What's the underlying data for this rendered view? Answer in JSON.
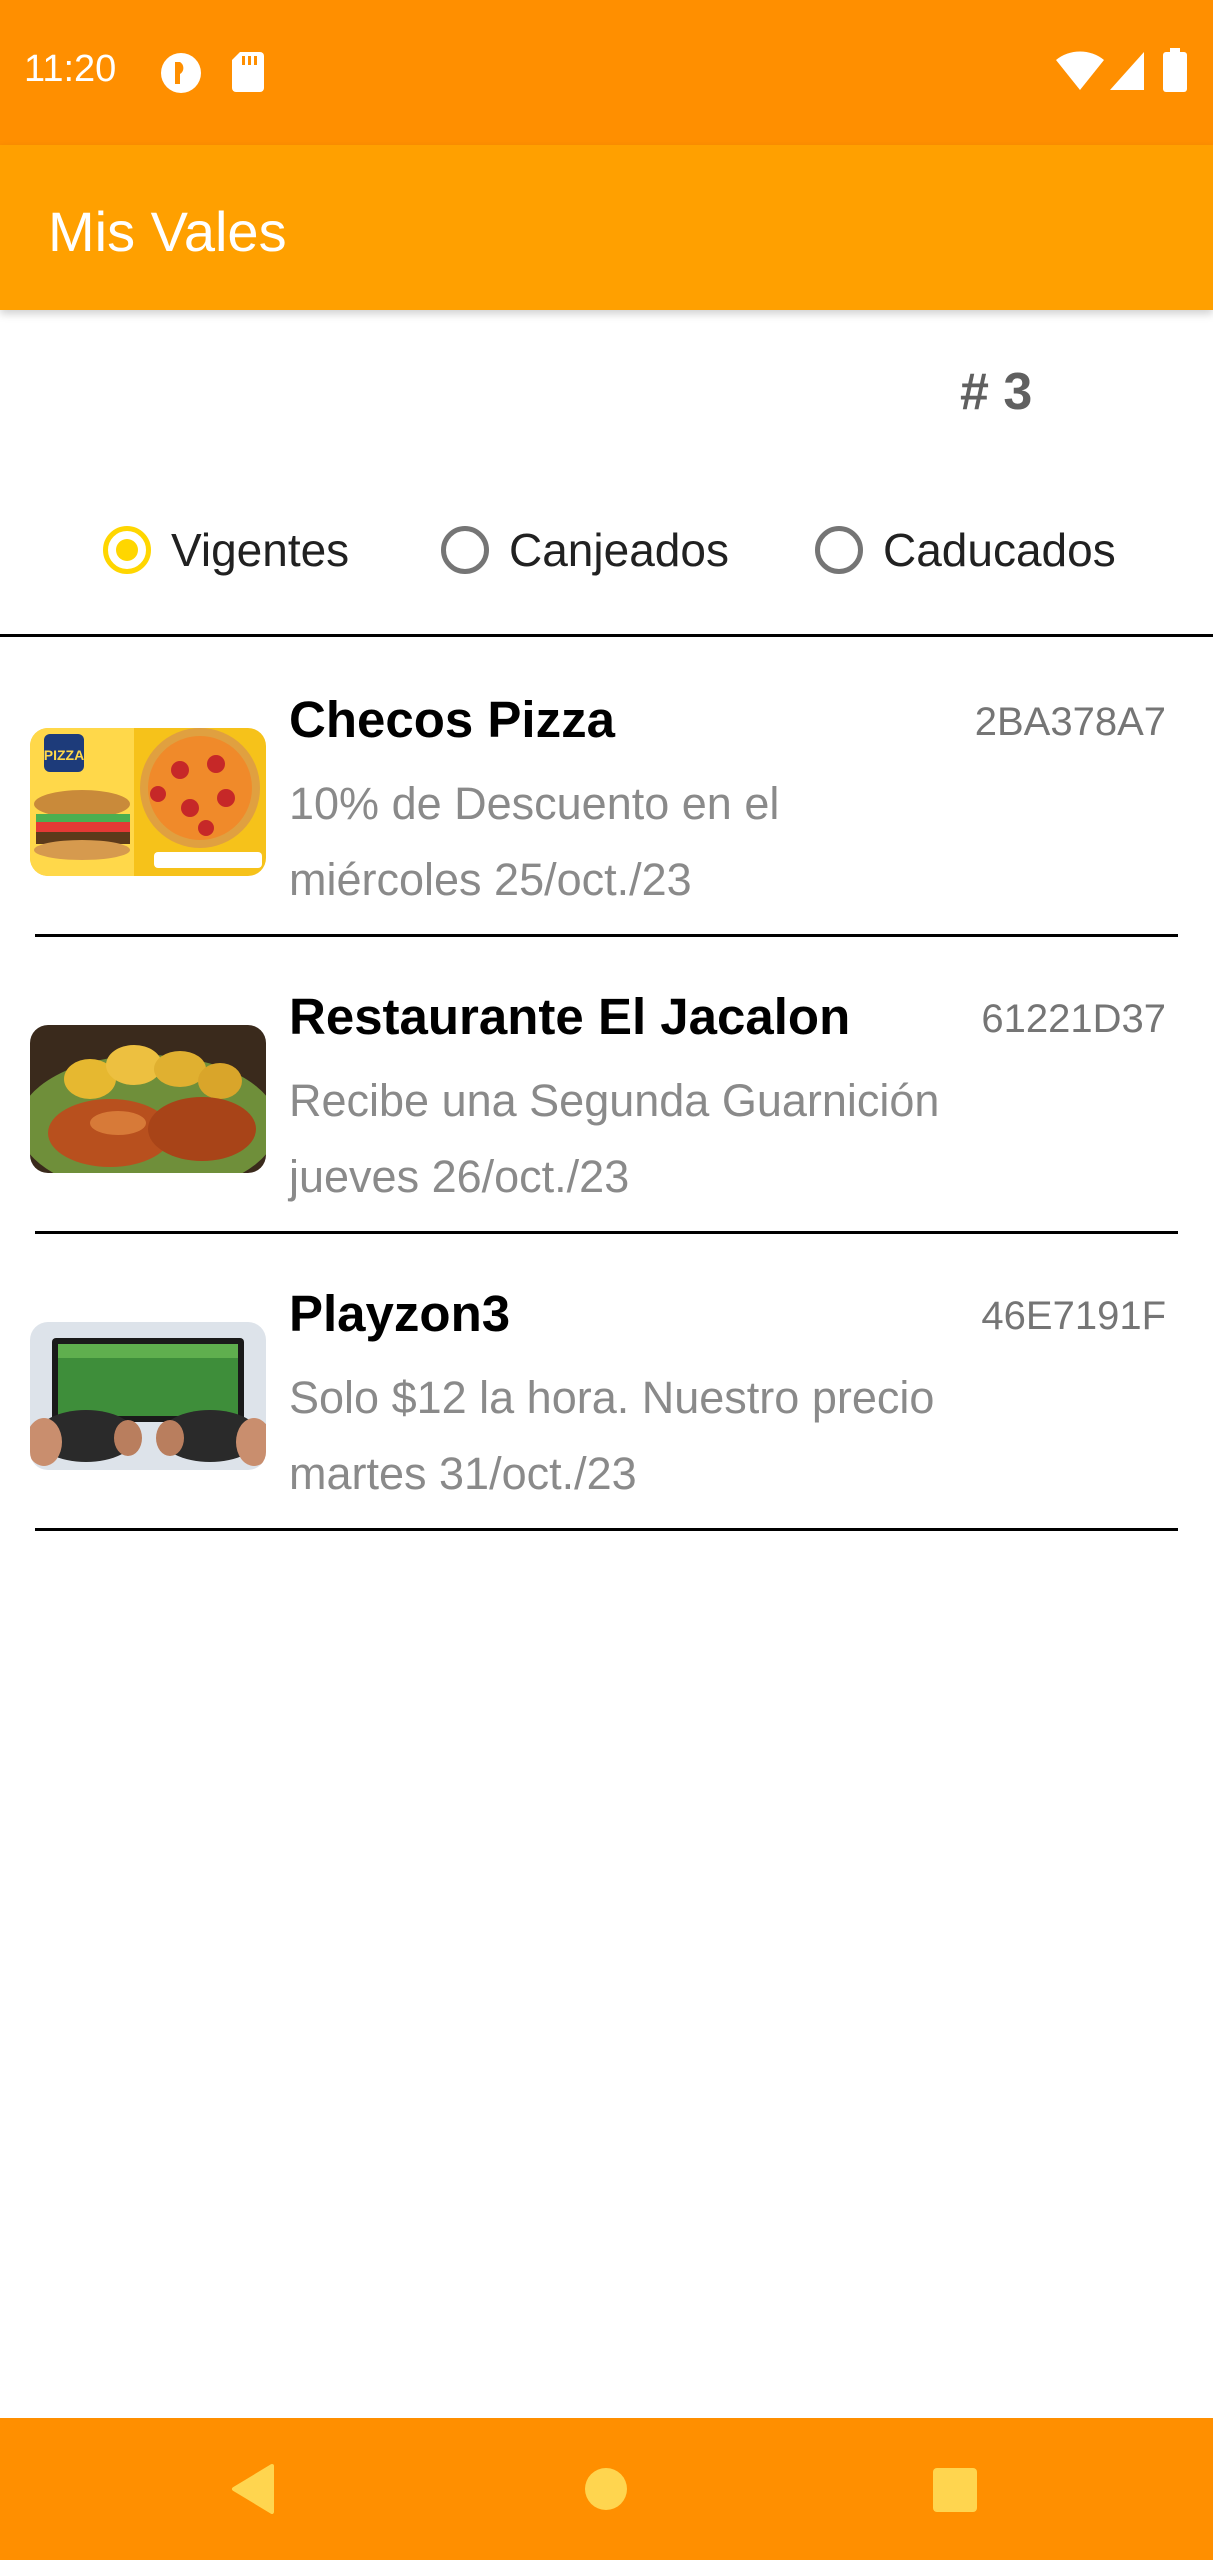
{
  "status_bar": {
    "time": "11:20",
    "left_icons": [
      "app-notification-icon",
      "sd-card-icon"
    ],
    "right_icons": [
      "wifi-icon",
      "cellular-signal-icon",
      "battery-icon"
    ]
  },
  "app_bar": {
    "title": "Mis Vales"
  },
  "count": {
    "label": "# 3"
  },
  "filters": {
    "selected": "Vigentes",
    "options": [
      {
        "label": "Vigentes"
      },
      {
        "label": "Canjeados"
      },
      {
        "label": "Caducados"
      }
    ]
  },
  "vouchers": [
    {
      "title": "Checos Pizza",
      "code": "2BA378A7",
      "description": "10% de Descuento en el",
      "date": "miércoles 25/oct./23",
      "image": "pizza-burger-promo-image"
    },
    {
      "title": "Restaurante El Jacalon",
      "code": "61221D37",
      "description": "Recibe una Segunda Guarnición",
      "date": "jueves 26/oct./23",
      "image": "roast-chicken-potatoes-image"
    },
    {
      "title": "Playzon3",
      "code": "46E7191F",
      "description": "Solo $12 la hora. Nuestro precio",
      "date": "martes 31/oct./23",
      "image": "video-game-controllers-image"
    }
  ],
  "nav_bar": {
    "buttons": [
      "back-icon",
      "home-icon",
      "recents-icon"
    ]
  },
  "colors": {
    "status_bar": "#FF8F00",
    "app_bar": "#FFA000",
    "radio_selected": "#FFD600",
    "nav_bar": "#FF8F00"
  }
}
